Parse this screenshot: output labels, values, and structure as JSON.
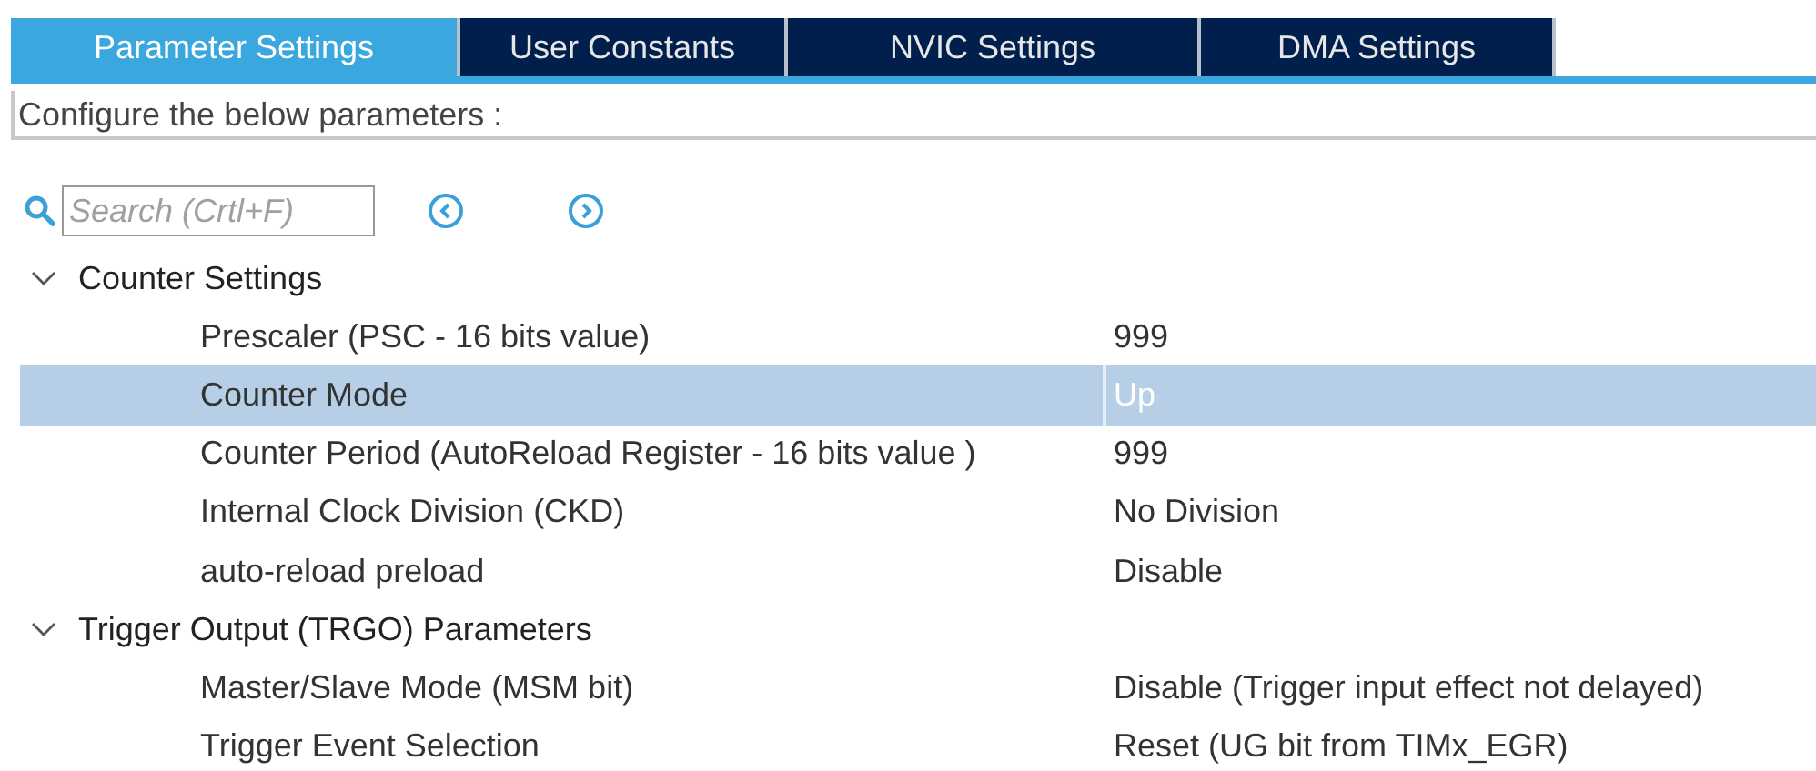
{
  "tabs": [
    {
      "label": "Parameter Settings",
      "selected": true
    },
    {
      "label": "User Constants",
      "selected": false
    },
    {
      "label": "NVIC Settings",
      "selected": false
    },
    {
      "label": "DMA Settings",
      "selected": false
    }
  ],
  "description": "Configure the below parameters :",
  "search": {
    "placeholder": "Search (Crtl+F)"
  },
  "groups": [
    {
      "label": "Counter Settings",
      "expanded": true,
      "children": [
        {
          "label": "Prescaler (PSC - 16 bits value)",
          "value": "999",
          "selected": false
        },
        {
          "label": "Counter Mode",
          "value": "Up",
          "selected": true
        },
        {
          "label": "Counter Period (AutoReload Register - 16 bits value )",
          "value": "999",
          "selected": false
        },
        {
          "label": "Internal Clock Division (CKD)",
          "value": "No Division",
          "selected": false
        },
        {
          "label": "auto-reload preload",
          "value": "Disable",
          "selected": false
        }
      ]
    },
    {
      "label": "Trigger Output (TRGO) Parameters",
      "expanded": true,
      "children": [
        {
          "label": "Master/Slave Mode (MSM bit)",
          "value": "Disable (Trigger input effect not delayed)",
          "selected": false
        },
        {
          "label": "Trigger Event Selection",
          "value": "Reset (UG bit from TIMx_EGR)",
          "selected": false
        }
      ]
    }
  ]
}
